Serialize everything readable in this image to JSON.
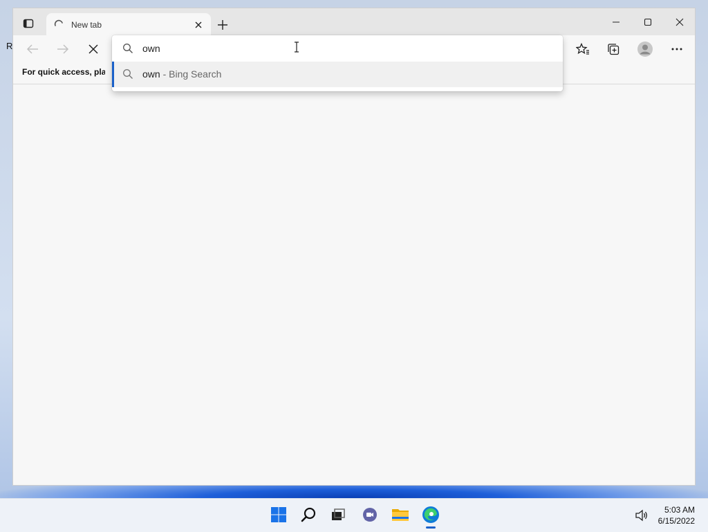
{
  "desktop": {
    "partial_label": "R"
  },
  "browser": {
    "tab": {
      "title": "New tab"
    },
    "favorites_bar": {
      "text": "For quick access, place y"
    },
    "omnibox": {
      "value": "own",
      "suggestions": [
        {
          "query": "own",
          "provider": " - Bing Search"
        }
      ]
    }
  },
  "taskbar": {
    "apps": [
      "start-icon",
      "search-icon",
      "task-view-icon",
      "teams-chat-icon",
      "file-explorer-icon",
      "edge-icon"
    ],
    "time": "5:03 AM",
    "date": "6/15/2022"
  },
  "colors": {
    "accent": "#1a61c9"
  }
}
